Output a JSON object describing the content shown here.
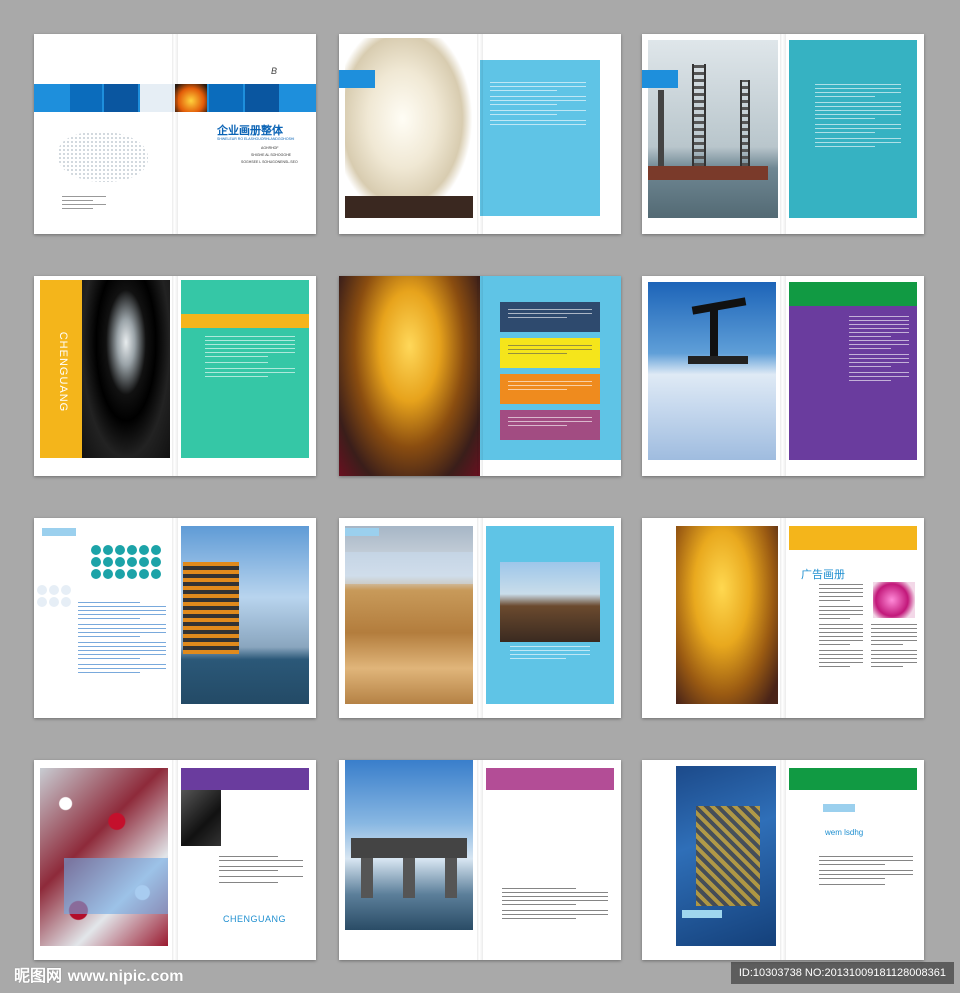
{
  "s1": {
    "brand_right": "企业画册整体",
    "sub_lines": [
      "SHWELEUR RO ELASHGUORHLANDGOHOSHI",
      "AGHRHOF",
      "SHIGHE AL SOHOGGHE",
      "SOGHSEE L SOHUGONENSL.SEO"
    ],
    "cover_label": "B"
  },
  "s4": {
    "vertical": "CHENGUANG"
  },
  "s12": {
    "heading": "广告画册"
  },
  "s15": {
    "label": "CHENGUANG"
  },
  "s18": {
    "label": "wem lsdhg"
  },
  "footer": {
    "logo": "昵图网",
    "site": "www.nipic.com",
    "id": "ID:10303738 NO:20131009181128008361"
  }
}
